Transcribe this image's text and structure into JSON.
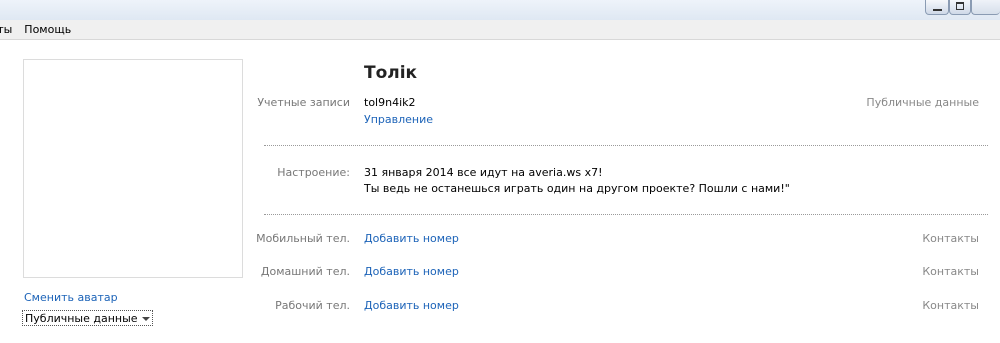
{
  "menu": {
    "tools_label": "нты",
    "help_label": "Помощь"
  },
  "avatar": {
    "change_label": "Сменить аватар",
    "privacy_label": "Публичные данные"
  },
  "profile": {
    "name": "Толік",
    "accounts": {
      "label": "Учетные записи",
      "value": "tol9n4ik2",
      "manage_label": "Управление",
      "privacy_label": "Публичные данные"
    },
    "mood": {
      "label": "Настроение:",
      "line1": "31 января 2014 все идут на averia.ws x7!",
      "line2": "Ты ведь не останешься играть один на другом проекте? Пошли с нами!\""
    },
    "phones": [
      {
        "label": "Мобильный тел.",
        "action": "Добавить номер",
        "privacy": "Контакты"
      },
      {
        "label": "Домашний тел.",
        "action": "Добавить номер",
        "privacy": "Контакты"
      },
      {
        "label": "Рабочий тел.",
        "action": "Добавить номер",
        "privacy": "Контакты"
      }
    ]
  }
}
